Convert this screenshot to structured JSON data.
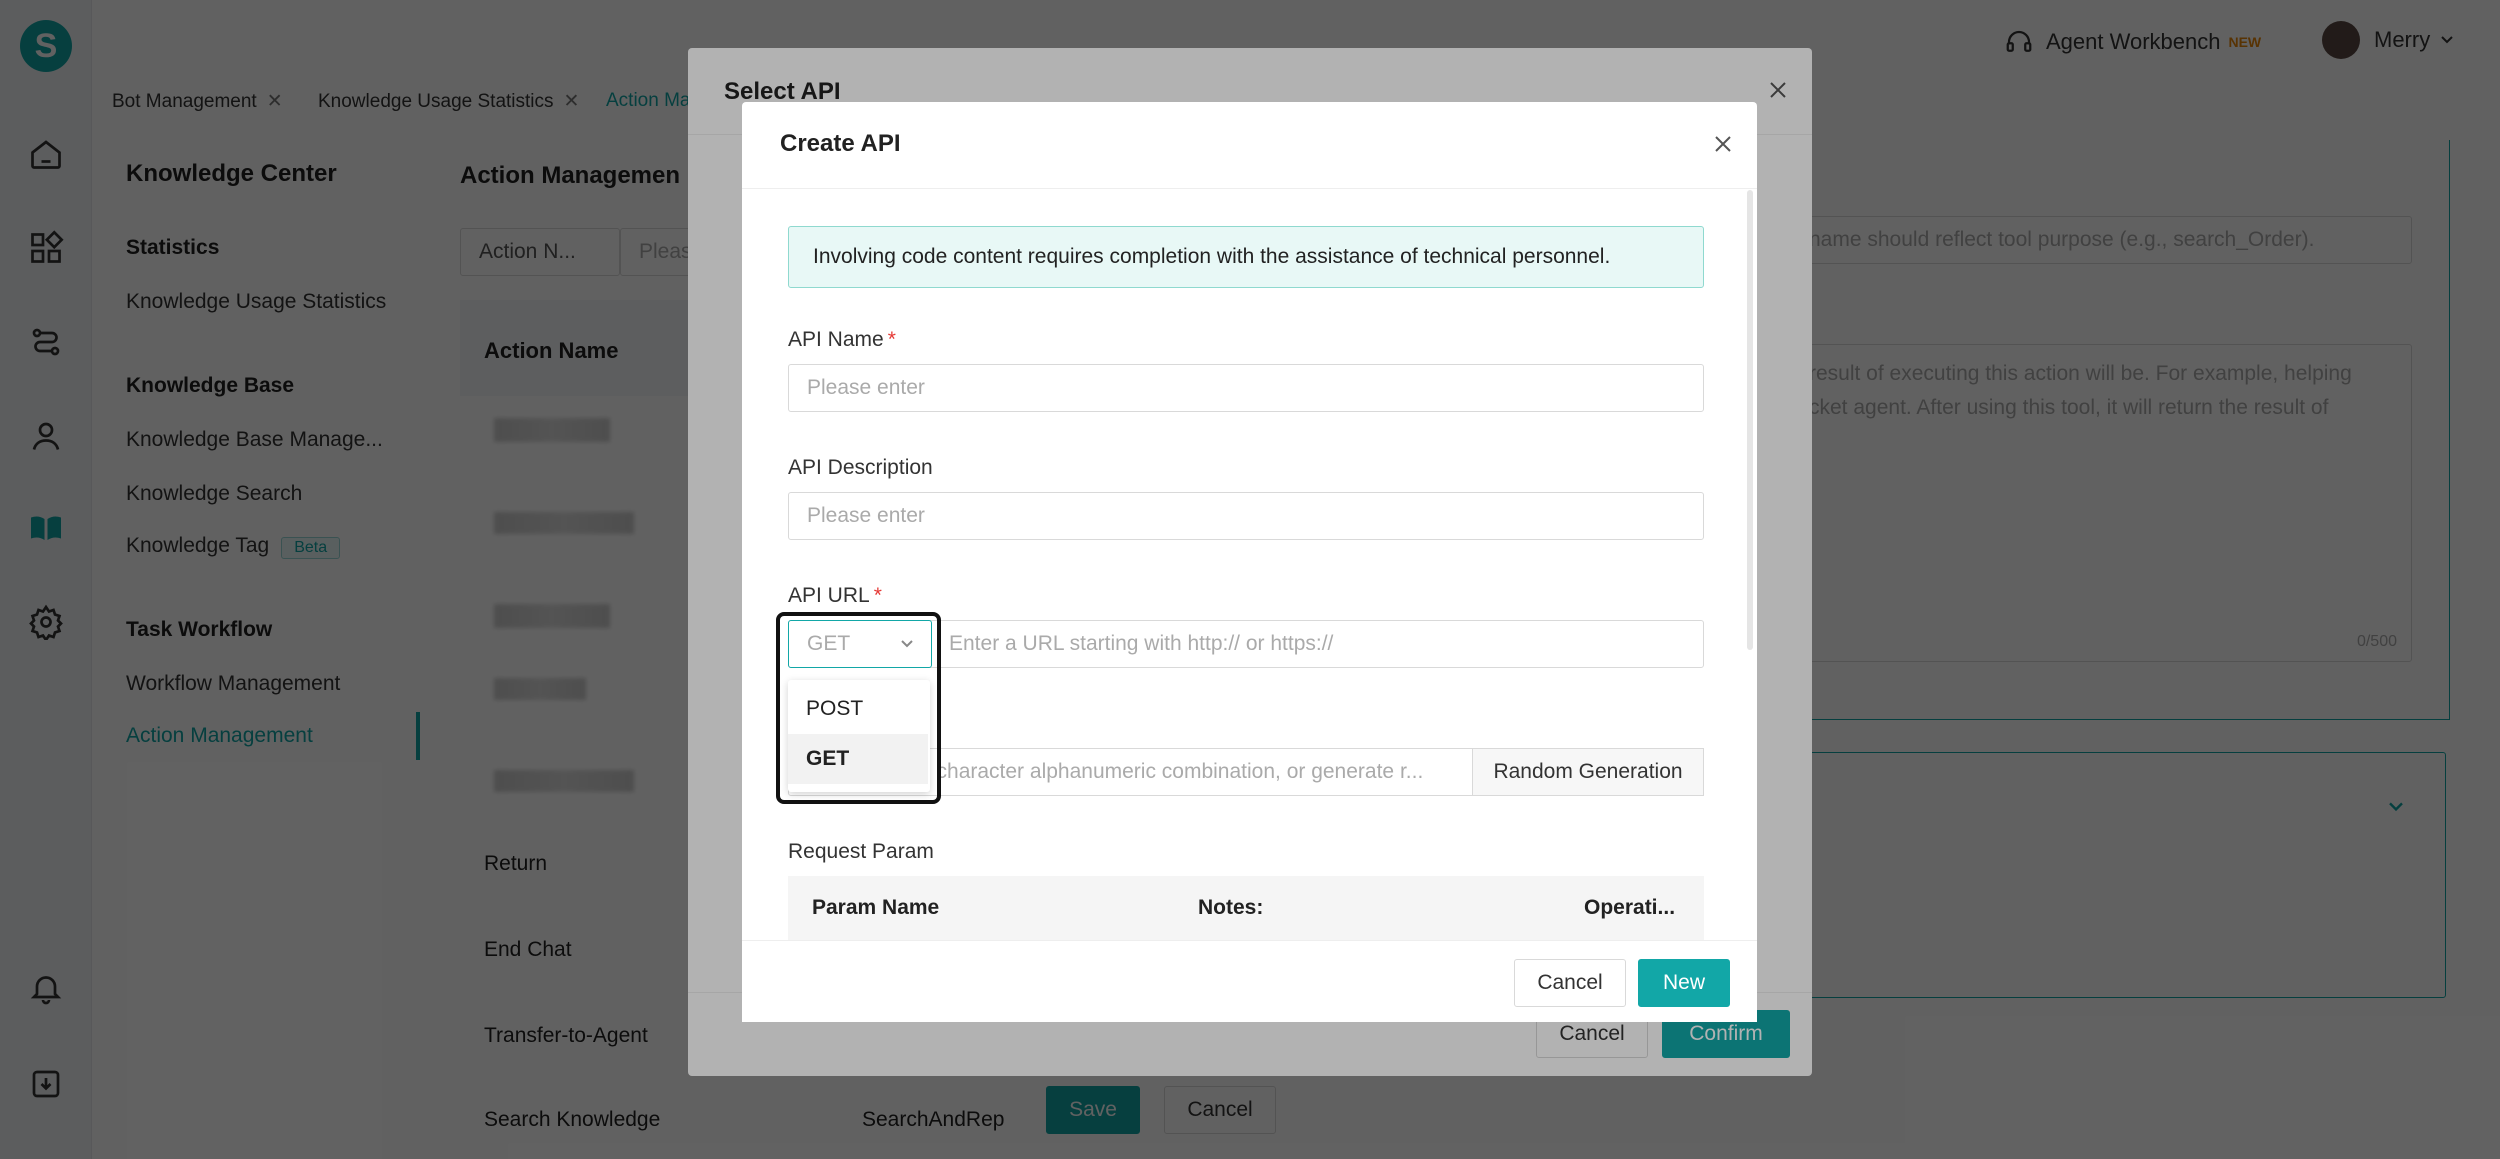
{
  "header": {
    "workbench_label": "Agent Workbench",
    "new_badge": "NEW",
    "user_name": "Merry"
  },
  "rail": {
    "logo_letter": "S",
    "icons": [
      "home-icon",
      "apps-icon",
      "flow-icon",
      "user-icon",
      "book-icon",
      "gear-icon",
      "bell-icon",
      "download-icon"
    ]
  },
  "tabs": [
    "Bot Management",
    "Knowledge Usage Statistics",
    "Action Ma"
  ],
  "sidebar": {
    "title": "Knowledge Center",
    "statistics": "Statistics",
    "knowledge_usage": "Knowledge Usage Statistics",
    "knowledge_base": "Knowledge Base",
    "kb_manage": "Knowledge Base Manage...",
    "kb_search": "Knowledge Search",
    "kb_tag": "Knowledge Tag",
    "beta": "Beta",
    "task_workflow": "Task Workflow",
    "workflow_mgmt": "Workflow Management",
    "action_mgmt": "Action Management"
  },
  "main": {
    "title": "Action Managemen",
    "filter_select": "Action N...",
    "filter_placeholder": "Pleas",
    "col_action_name": "Action Name",
    "rows": [
      "Return",
      "End Chat",
      "Transfer-to-Agent",
      "Search Knowledge"
    ],
    "row4_code": "SearchAndRep",
    "save": "Save",
    "cancel": "Cancel"
  },
  "bg_right": {
    "name_hint": "name should reflect tool purpose (e.g., search_Order).",
    "desc_line1": "result of executing this action will be. For example, helping",
    "desc_line2": "cket agent. After using this tool, it will return the result of",
    "counter": "0/500"
  },
  "select_api": {
    "title": "Select API",
    "cancel": "Cancel",
    "confirm": "Confirm"
  },
  "create_api": {
    "title": "Create API",
    "notice": "Involving code content requires completion with the assistance of technical personnel.",
    "api_name_label": "API Name",
    "api_name_placeholder": "Please enter",
    "api_desc_label": "API Description",
    "api_desc_placeholder": "Please enter",
    "api_url_label": "API URL",
    "method_value": "GET",
    "url_placeholder": "Enter a URL starting with http:// or https://",
    "method_options": [
      "POST",
      "GET"
    ],
    "key_placeholder": "2 character alphanumeric combination, or generate r...",
    "random_btn": "Random Generation",
    "request_param_label": "Request Param",
    "table_headers": [
      "Param Name",
      "Notes:",
      "Operati..."
    ],
    "cancel": "Cancel",
    "new": "New"
  }
}
